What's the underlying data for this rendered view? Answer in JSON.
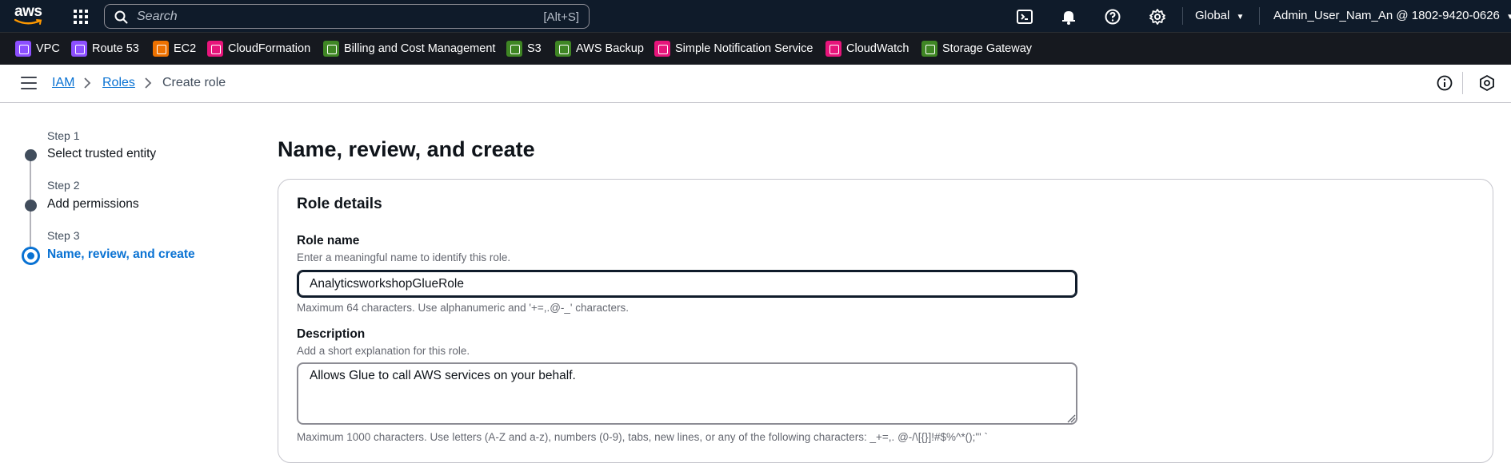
{
  "topnav": {
    "logo_text": "aws",
    "search_placeholder": "Search",
    "search_shortcut": "[Alt+S]",
    "region": "Global",
    "account": "Admin_User_Nam_An @ 1802-9420-0626"
  },
  "favorites": [
    {
      "label": "VPC",
      "color": "#8c4fff"
    },
    {
      "label": "Route 53",
      "color": "#8c4fff"
    },
    {
      "label": "EC2",
      "color": "#ed7100"
    },
    {
      "label": "CloudFormation",
      "color": "#e7157b"
    },
    {
      "label": "Billing and Cost Management",
      "color": "#3f8624"
    },
    {
      "label": "S3",
      "color": "#3f8624"
    },
    {
      "label": "AWS Backup",
      "color": "#3f8624"
    },
    {
      "label": "Simple Notification Service",
      "color": "#e7157b"
    },
    {
      "label": "CloudWatch",
      "color": "#e7157b"
    },
    {
      "label": "Storage Gateway",
      "color": "#3f8624"
    }
  ],
  "breadcrumb": {
    "items": [
      "IAM",
      "Roles"
    ],
    "current": "Create role"
  },
  "steps": [
    {
      "label": "Step 1",
      "title": "Select trusted entity",
      "active": false
    },
    {
      "label": "Step 2",
      "title": "Add permissions",
      "active": false
    },
    {
      "label": "Step 3",
      "title": "Name, review, and create",
      "active": true
    }
  ],
  "page": {
    "title": "Name, review, and create"
  },
  "role_details": {
    "title": "Role details",
    "role_name": {
      "label": "Role name",
      "description": "Enter a meaningful name to identify this role.",
      "value": "AnalyticsworkshopGlueRole",
      "constraint": "Maximum 64 characters. Use alphanumeric and '+=,.@-_' characters."
    },
    "description": {
      "label": "Description",
      "description": "Add a short explanation for this role.",
      "value": "Allows Glue to call AWS services on your behalf.",
      "constraint": "Maximum 1000 characters. Use letters (A-Z and a-z), numbers (0-9), tabs, new lines, or any of the following characters: _+=,. @-/\\[{}]!#$%^*();\"' `"
    }
  },
  "colors": {
    "accent": "#0972d3",
    "nav_bg": "#0f1b2a",
    "favbar_bg": "#16191f"
  }
}
